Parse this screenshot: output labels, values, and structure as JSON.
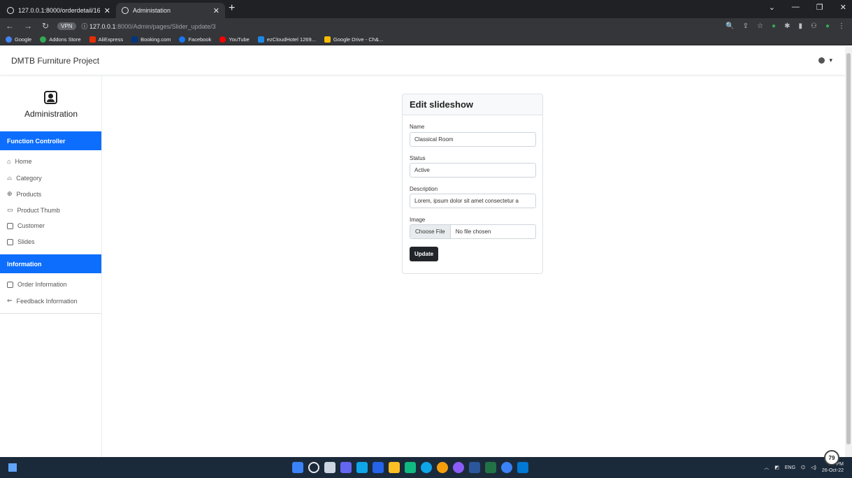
{
  "browser": {
    "tabs": [
      {
        "label": "127.0.0.1:8000/orderdetail/16"
      },
      {
        "label": "Administation"
      }
    ],
    "new_tab": "+",
    "url_host": "127.0.0.1",
    "url_rest": ":8000/Admin/pages/Slider_update/3",
    "ext_badge": "VPN",
    "bookmarks": [
      {
        "label": "Google",
        "color": "#4285f4"
      },
      {
        "label": "Addons Store",
        "color": "#34a853"
      },
      {
        "label": "AliExpress",
        "color": "#e62e04"
      },
      {
        "label": "Booking.com",
        "color": "#003580"
      },
      {
        "label": "Facebook",
        "color": "#1877f2"
      },
      {
        "label": "YouTube",
        "color": "#ff0000"
      },
      {
        "label": "ezCloudHotel 1269...",
        "color": "#1e88e5"
      },
      {
        "label": "Google Drive - Ch&...",
        "color": "#fbbc04"
      }
    ]
  },
  "topnav": {
    "brand": "DMTB Furniture Project"
  },
  "sidebar": {
    "title": "Administration",
    "section_function": "Function Controller",
    "function_items": [
      {
        "label": "Home"
      },
      {
        "label": "Category"
      },
      {
        "label": "Products"
      },
      {
        "label": "Product Thumb"
      },
      {
        "label": "Customer"
      },
      {
        "label": "Slides"
      }
    ],
    "section_information": "Information",
    "information_items": [
      {
        "label": "Order Information"
      },
      {
        "label": "Feedback Information"
      }
    ]
  },
  "form": {
    "title": "Edit slideshow",
    "name_label": "Name",
    "name_value": "Classical Room",
    "status_label": "Status",
    "status_value": "Active",
    "description_label": "Description",
    "description_value": "Lorem, ipsum dolor sit amet consectetur a",
    "image_label": "Image",
    "choose_file": "Choose File",
    "no_file": "No file chosen",
    "update_button": "Update"
  },
  "taskbar": {
    "badge": "79",
    "lang": "ENG",
    "date": "26-Oct-22",
    "time": "PM"
  },
  "colors": {
    "primary": "#0d6efd",
    "dark_button": "#212529"
  }
}
